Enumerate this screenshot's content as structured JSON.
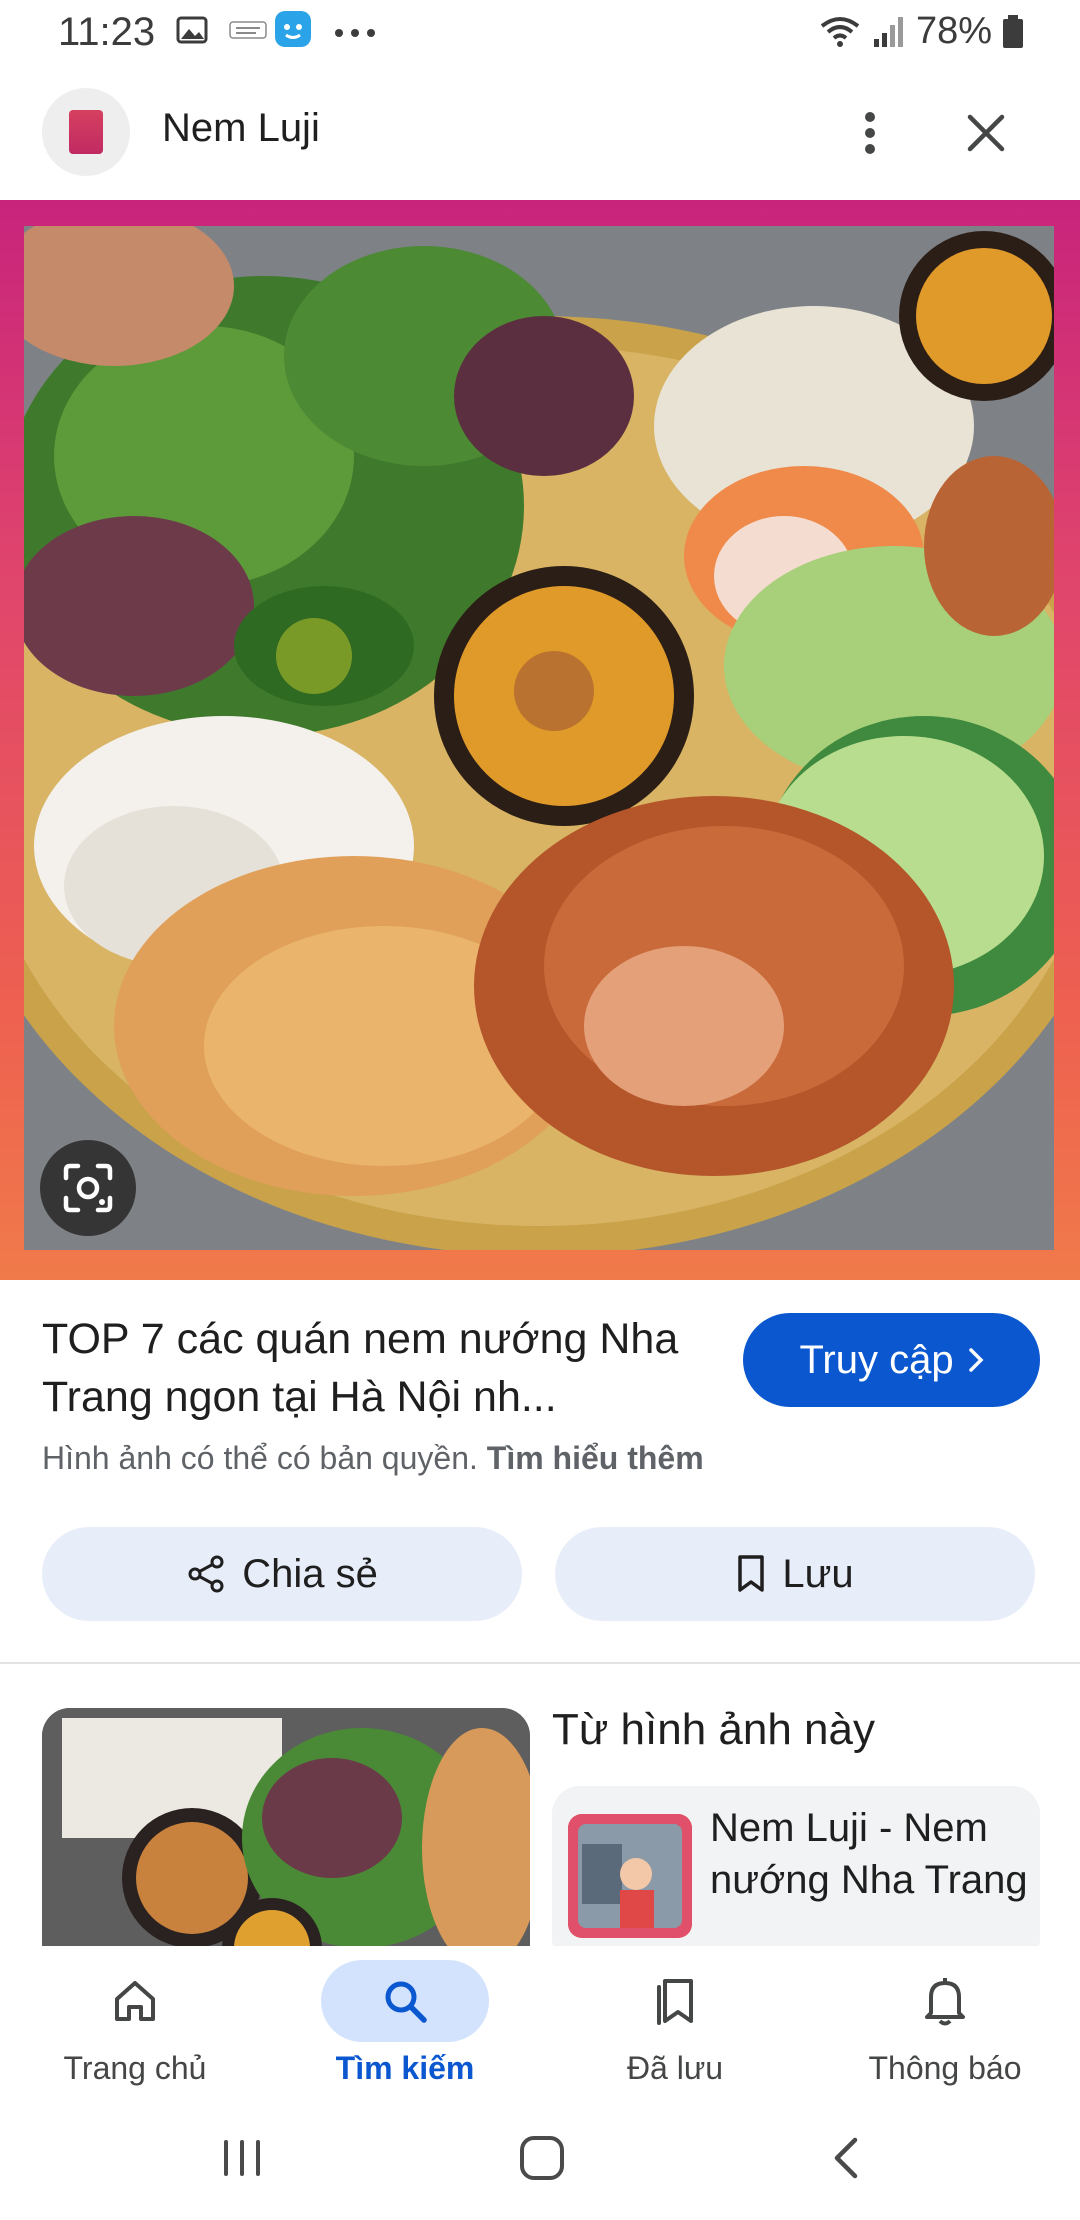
{
  "status_bar": {
    "time": "11:23",
    "battery": "78%",
    "notification_icons": [
      "gallery-icon",
      "grab-merchant-icon",
      "app-icon",
      "more-dots-icon"
    ]
  },
  "header": {
    "title": "Nem Luji",
    "avatar_icon": "site-logo-icon"
  },
  "result": {
    "title": "TOP 7 các quán nem nướng Nha Trang ngon tại Hà Nội nh...",
    "visit_label": "Truy cập",
    "copyright_text": "Hình ảnh có thể có bản quyền.",
    "learn_more": "Tìm hiểu thêm"
  },
  "actions": {
    "share_label": "Chia sẻ",
    "save_label": "Lưu"
  },
  "from_image": {
    "title": "Từ hình ảnh này",
    "source_title": "Nem Luji - Nem nướng Nha Trang"
  },
  "bottom_nav": {
    "items": [
      {
        "label": "Trang chủ",
        "icon": "home-icon"
      },
      {
        "label": "Tìm kiếm",
        "icon": "search-icon",
        "active": true
      },
      {
        "label": "Đã lưu",
        "icon": "saved-icon"
      },
      {
        "label": "Thông báo",
        "icon": "bell-icon"
      }
    ]
  },
  "colors": {
    "primary": "#0b57d0",
    "chip_bg": "#e8eef9",
    "frame_top": "#c8247c",
    "frame_bottom": "#f07a4a"
  }
}
